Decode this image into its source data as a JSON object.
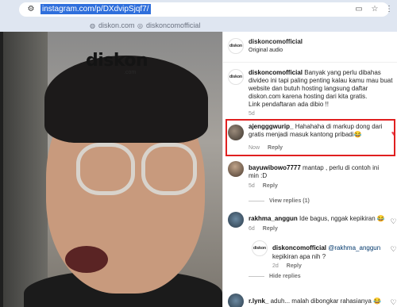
{
  "browser": {
    "url": "instagram.com/p/DXdvipSjqf7/",
    "bookmarks": [
      {
        "label": "diskon.com",
        "icon": "globe-icon"
      },
      {
        "label": "diskoncomofficial",
        "icon": "instagram-icon"
      }
    ]
  },
  "video": {
    "logo_text": "diskon",
    "logo_sub": ".com"
  },
  "post": {
    "author": "diskoncomofficial",
    "audio": "Original audio",
    "avatar_text": "diskon",
    "caption_user": "diskoncomofficial",
    "caption": "Banyak yang perlu dibahas divideo ini tapi paling penting kalau kamu mau buat website dan butuh hosting langsung daftar diskon.com karena hosting dari kita gratis.",
    "caption_line2": "Link pendaftaran ada dibio !!",
    "caption_time": "5d"
  },
  "comments": [
    {
      "user": "ajengggwurip_",
      "text": "Hahahaha di markup dong dari gratis menjadi masuk kantong pribadi😂",
      "time": "Now",
      "reply": "Reply",
      "liked": true
    },
    {
      "user": "bayuwibowo7777",
      "text": "mantap , perlu di contoh ini min :D",
      "time": "5d",
      "reply": "Reply",
      "view_replies": "View replies (1)"
    },
    {
      "user": "rakhma_anggun",
      "text": "Ide bagus, nggak kepikiran 😂",
      "time": "6d",
      "reply": "Reply"
    },
    {
      "user": "diskoncomofficial",
      "mention": "@rakhma_anggun",
      "text": "kepikiran apa nih ?",
      "time": "2d",
      "reply": "Reply",
      "hide_replies": "Hide replies",
      "avatar_text": "diskon"
    },
    {
      "user": "r.lynk_",
      "text": "aduh... malah dibongkar rahasianya 😂"
    }
  ]
}
